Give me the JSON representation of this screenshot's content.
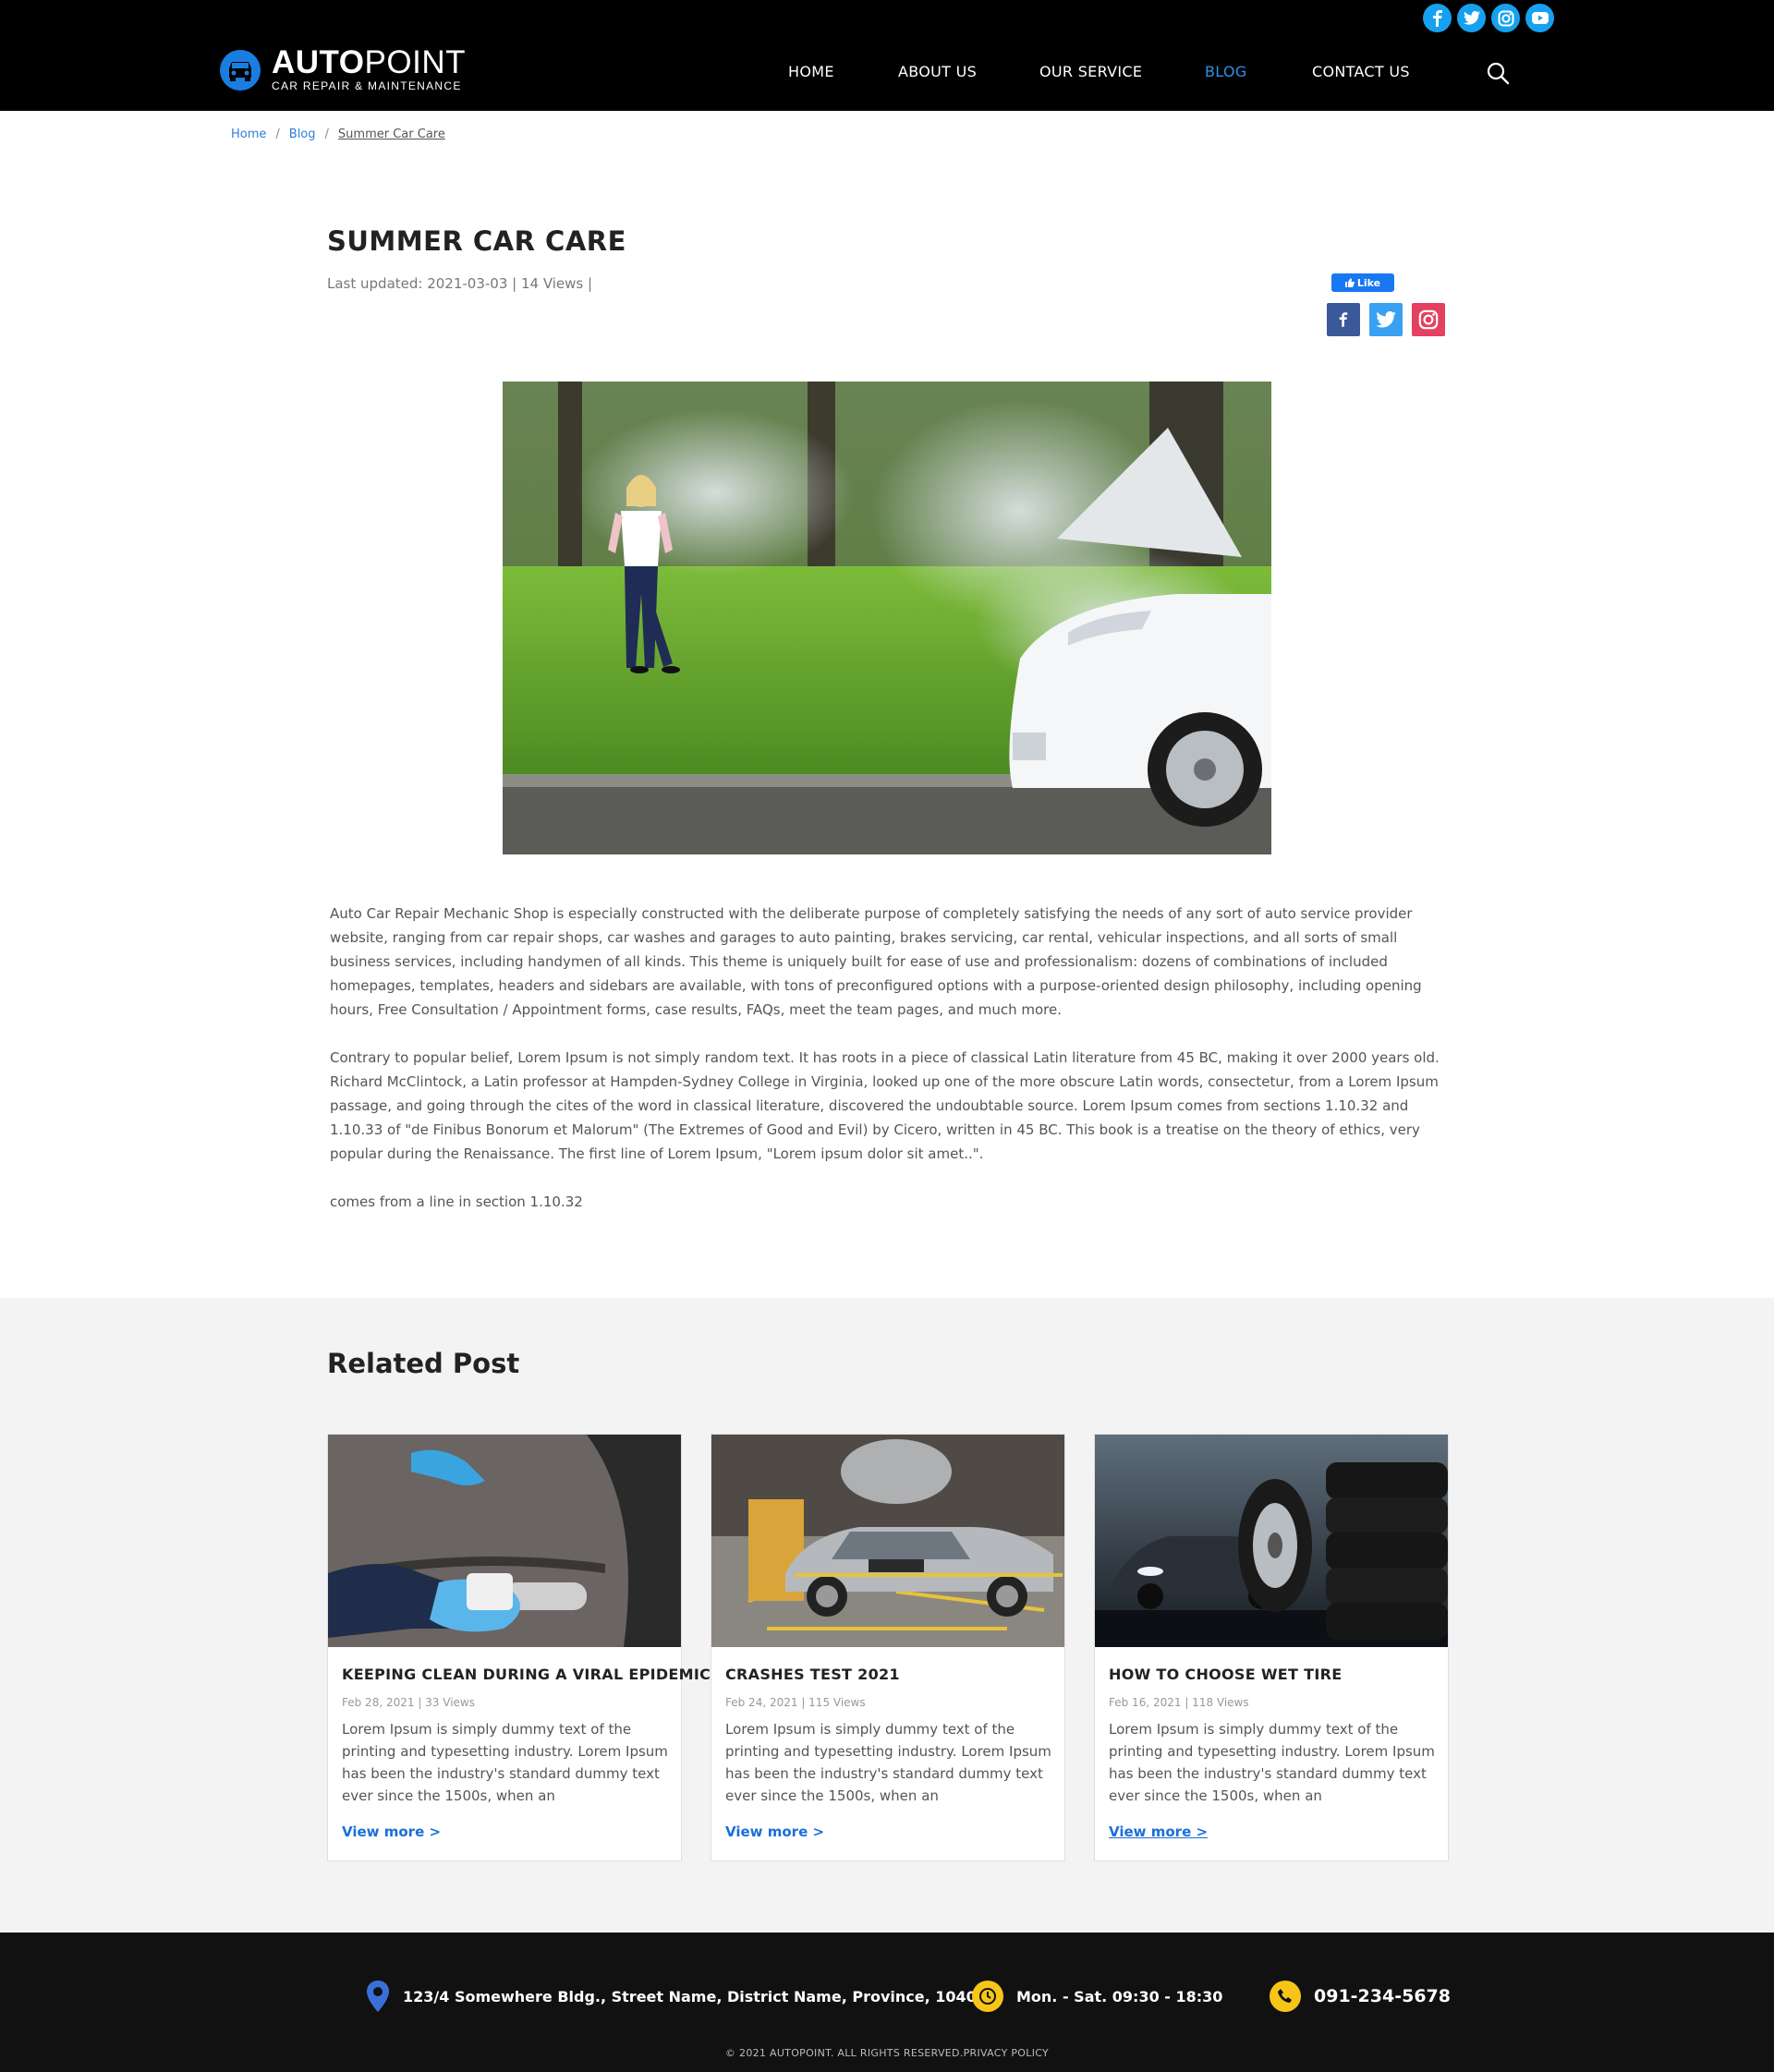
{
  "header": {
    "logo": {
      "brand_bold": "AUTO",
      "brand_light": "POINT",
      "tagline": "CAR REPAIR & MAINTENANCE"
    },
    "social": [
      "facebook-icon",
      "twitter-icon",
      "instagram-icon",
      "youtube-icon"
    ],
    "nav": [
      {
        "label": "HOME",
        "active": false
      },
      {
        "label": "ABOUT US",
        "active": false
      },
      {
        "label": "OUR SERVICE",
        "active": false
      },
      {
        "label": "BLOG",
        "active": true
      },
      {
        "label": "CONTACT US",
        "active": false
      }
    ],
    "accent": "#2f8fe8"
  },
  "breadcrumb": {
    "home": "Home",
    "blog": "Blog",
    "current": "Summer Car Care",
    "sep": "/"
  },
  "article": {
    "title": "SUMMER CAR CARE",
    "meta": "Last updated: 2021-03-03 |  14 Views  |",
    "like_label": "Like",
    "share": [
      "facebook-icon",
      "twitter-icon",
      "instagram-icon"
    ],
    "paragraphs": [
      "Auto Car Repair Mechanic Shop is especially constructed with the deliberate purpose of completely satisfying the needs of any sort of auto service provider website, ranging from car repair shops, car washes and garages to auto painting, brakes servicing, car rental, vehicular inspections, and all sorts of small business services, including handymen of all kinds. This theme is uniquely built for ease of use and professionalism: dozens of combinations of included homepages, templates, headers and sidebars are available, with tons of preconfigured options with a purpose-oriented design philosophy, including opening hours, Free Consultation / Appointment forms, case results, FAQs, meet the team pages, and much more.",
      "Contrary to popular belief, Lorem Ipsum is not simply random text. It has roots in a piece of classical Latin literature from 45 BC, making it over 2000 years old. Richard McClintock, a Latin professor at Hampden-Sydney College in Virginia, looked up one of the more obscure Latin words, consectetur, from a Lorem Ipsum passage, and going through the cites of the word in classical literature, discovered the undoubtable source. Lorem Ipsum comes from sections 1.10.32 and 1.10.33 of \"de Finibus Bonorum et Malorum\" (The Extremes of Good and Evil) by Cicero, written in 45 BC. This book is a treatise on the theory of ethics, very popular during the Renaissance. The first line of Lorem Ipsum, \"Lorem ipsum dolor sit amet..\".",
      "comes from a line in section 1.10.32"
    ]
  },
  "related": {
    "title": "Related Post",
    "cards": [
      {
        "title": "KEEPING CLEAN DURING A VIRAL EPIDEMIC",
        "meta": "Feb 28, 2021  |  33 Views",
        "excerpt": "Lorem Ipsum is simply dummy text of the printing and typesetting industry. Lorem Ipsum has been the industry's standard dummy text ever since the 1500s, when an",
        "more": "View more >"
      },
      {
        "title": "CRASHES TEST 2021",
        "meta": "Feb 24, 2021  |  115 Views",
        "excerpt": "Lorem Ipsum is simply dummy text of the printing and typesetting industry. Lorem Ipsum has been the industry's standard dummy text ever since the 1500s, when an",
        "more": "View more >"
      },
      {
        "title": "HOW TO CHOOSE WET TIRE",
        "meta": "Feb 16, 2021  |  118 Views",
        "excerpt": "Lorem Ipsum is simply dummy text of the printing and typesetting industry. Lorem Ipsum has been the industry's standard dummy text ever since the 1500s, when an",
        "more": "View more >"
      }
    ]
  },
  "footer": {
    "address": "123/4 Somewhere Bldg., Street Name, District Name, Province, 10400",
    "hours": "Mon. - Sat.  09:30 - 18:30",
    "phone": "091-234-5678",
    "copyright": "©  2021 AUTOPOINT. ALL RIGHTS RESERVED.PRIVACY POLICY",
    "icon_color": "#f5c518"
  }
}
